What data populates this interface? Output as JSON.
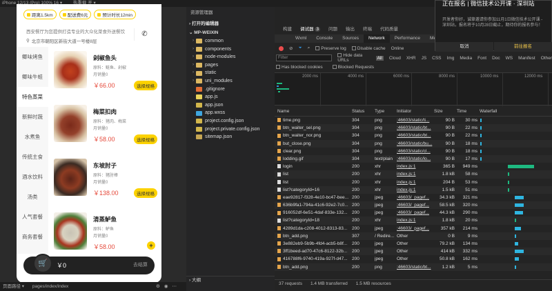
{
  "topbar": {
    "device": "iPhone 12/13 (Pro) 100% 16 ▾",
    "hot_reload": "热重载 开 ▾",
    "explorer_title": "资源管理器"
  },
  "phone": {
    "badges": [
      {
        "icon": "location-icon",
        "text": "距离1.5km"
      },
      {
        "icon": "delivery-icon",
        "text": "配送费6元"
      },
      {
        "icon": "clock-icon",
        "text": "预计时长12min"
      }
    ],
    "notice": "西安餐厅为您提供打造专业的大众化菜食外送餐饮",
    "address": "北京市朝阳区新街大道一号楼8层",
    "categories": [
      "鲫味烤鱼",
      "鲫味牛蛙",
      "特色蒸菜",
      "新鲜时蔬",
      "水煮鱼",
      "传统主食",
      "酒水饮料",
      "汤类",
      "人气套餐",
      "商务套餐"
    ],
    "active_category": "特色蒸菜",
    "goods": [
      {
        "name": "剁椒鱼头",
        "material": "原料：鲢鱼、剁椒",
        "sales": "月销量0",
        "price": "￥66.00",
        "action": "选择规格"
      },
      {
        "name": "梅菜扣肉",
        "material": "原料：猪肉、梅菜",
        "sales": "月销量0",
        "price": "￥58.00",
        "action": "选择规格"
      },
      {
        "name": "东坡肘子",
        "material": "原料：猪肘棒",
        "sales": "月销量0",
        "price": "￥138.00",
        "action": "选择规格"
      },
      {
        "name": "清蒸鲈鱼",
        "material": "原料：鲈鱼",
        "sales": "月销量0",
        "price": "￥58.00",
        "action": "+"
      }
    ],
    "cart": {
      "amount": "￥0",
      "right_text": "去结算"
    }
  },
  "statusbar": {
    "path_label": "页面路径 ▾",
    "path": "pages/index/index"
  },
  "explorer": {
    "title": "资源管理器",
    "open_editors": "打开的编辑器",
    "project": "MP-WEIXIN",
    "items": [
      {
        "name": "common",
        "type": "folder"
      },
      {
        "name": "components",
        "type": "folder"
      },
      {
        "name": "node-modules",
        "type": "folder"
      },
      {
        "name": "pages",
        "type": "folder"
      },
      {
        "name": "static",
        "type": "folder"
      },
      {
        "name": "uni_modules",
        "type": "folder"
      },
      {
        "name": ".gitignore",
        "type": "git"
      },
      {
        "name": "app.js",
        "type": "js"
      },
      {
        "name": "app.json",
        "type": "json"
      },
      {
        "name": "app.wxss",
        "type": "wxss"
      },
      {
        "name": "project.config.json",
        "type": "json"
      },
      {
        "name": "project.private.config.json",
        "type": "json"
      },
      {
        "name": "sitemap.json",
        "type": "map"
      }
    ],
    "outline": "大纲"
  },
  "devtools": {
    "panel_tabs": [
      "构建",
      "调试器",
      "问题",
      "输出",
      "终端",
      "代码质量"
    ],
    "panel_badge": "3",
    "active_panel": "调试器",
    "tabs": [
      "Wxml",
      "Console",
      "Sources",
      "Network",
      "Performance",
      "Memory"
    ],
    "active_tab": "Network",
    "toolbar": {
      "preserve_log": "Preserve log",
      "disable_cache": "Disable cache",
      "throttle": "Online"
    },
    "filter": {
      "placeholder": "Filter",
      "hide_data_urls": "Hide data URLs",
      "types": [
        "All",
        "Cloud",
        "XHR",
        "JS",
        "CSS",
        "Img",
        "Media",
        "Font",
        "Doc",
        "WS",
        "Manifest",
        "Other"
      ],
      "active_type": "All"
    },
    "blocked": {
      "cookies": "Has blocked cookies",
      "requests": "Blocked Requests"
    },
    "timeline_labels": [
      "2000 ms",
      "4000 ms",
      "6000 ms",
      "8000 ms",
      "10000 ms",
      "12000 ms"
    ],
    "columns": [
      "Name",
      "Status",
      "Type",
      "Initiator",
      "Size",
      "Time",
      "Waterfall"
    ],
    "rows": [
      {
        "name": "time.png",
        "status": "304",
        "type": "png",
        "initiator": ":46603/static/ti...",
        "size": "90 B",
        "time": "30 ms"
      },
      {
        "name": "btn_waiter_sel.png",
        "status": "304",
        "type": "png",
        "initiator": ":46603/static/bt...",
        "size": "90 B",
        "time": "22 ms"
      },
      {
        "name": "btn_waiter_nor.png",
        "status": "304",
        "type": "png",
        "initiator": ":46603/static/bt...",
        "size": "90 B",
        "time": "22 ms"
      },
      {
        "name": "but_close.png",
        "status": "304",
        "type": "png",
        "initiator": ":46603/static/bu...",
        "size": "90 B",
        "time": "18 ms"
      },
      {
        "name": "clear.png",
        "status": "304",
        "type": "png",
        "initiator": ":46603/static/cl...",
        "size": "90 B",
        "time": "18 ms"
      },
      {
        "name": "lodding.gif",
        "status": "304",
        "type": "text/plain",
        "initiator": ":46603/static/lo...",
        "size": "90 B",
        "time": "17 ms"
      },
      {
        "name": "login",
        "status": "200",
        "type": "xhr",
        "initiator": "index.js:1",
        "size": "365 B",
        "time": "949 ms"
      },
      {
        "name": "list",
        "status": "200",
        "type": "xhr",
        "initiator": "index.js:1",
        "size": "1.8 kB",
        "time": "58 ms"
      },
      {
        "name": "list",
        "status": "200",
        "type": "xhr",
        "initiator": "index.js:1",
        "size": "204 B",
        "time": "53 ms"
      },
      {
        "name": "list?categoryId=16",
        "status": "200",
        "type": "xhr",
        "initiator": "index.js:1",
        "size": "1.5 kB",
        "time": "51 ms"
      },
      {
        "name": "eae92817-f328-4e10-bc47-bee...",
        "status": "200",
        "type": "jpeg",
        "initiator": ":46603/_pagef...",
        "size": "34.3 kB",
        "time": "321 ms"
      },
      {
        "name": "636b9fa1-794a-41c6-92e2-7c0...",
        "status": "200",
        "type": "jpeg",
        "initiator": ":46603/_pagef...",
        "size": "58.5 kB",
        "time": "320 ms"
      },
      {
        "name": "916052df-6e51-4daf-833e-132...",
        "status": "200",
        "type": "jpeg",
        "initiator": ":46603/_pagef...",
        "size": "44.3 kB",
        "time": "290 ms"
      },
      {
        "name": "list?categoryId=18",
        "status": "200",
        "type": "xhr",
        "initiator": "index.js:1",
        "size": "1.8 kB",
        "time": "20 ms"
      },
      {
        "name": "4289d1da-c208-4012-8313-83...",
        "status": "200",
        "type": "jpeg",
        "initiator": ":46603/_pagef...",
        "size": "357 kB",
        "time": "214 ms"
      },
      {
        "name": "btn_add.png",
        "status": "307",
        "type": "/ Redire...",
        "initiator": "Other",
        "size": "0 B",
        "time": "9 ms"
      },
      {
        "name": "3e882eb9-5b9b-4fd4-acb5-b8f...",
        "status": "200",
        "type": "jpeg",
        "initiator": "Other",
        "size": "79.2 kB",
        "time": "134 ms"
      },
      {
        "name": "3ff1beed-ad70-47c6-8122-32b...",
        "status": "200",
        "type": "jpeg",
        "initiator": "Other",
        "size": "414 kB",
        "time": "332 ms"
      },
      {
        "name": "416788f6-9740-419a-927f-d47...",
        "status": "200",
        "type": "jpeg",
        "initiator": "Other",
        "size": "50.8 kB",
        "time": "162 ms"
      },
      {
        "name": "btn_add.png",
        "status": "200",
        "type": "png",
        "initiator": ":46603/static/bt...",
        "size": "1.2 kB",
        "time": "5 ms"
      }
    ],
    "footer": {
      "requests": "37 requests",
      "transferred": "1.4 MB transferred",
      "resources": "1.5 MB resources"
    }
  },
  "notification": {
    "title": "正在报名 | 微信技术公开课 · 深圳站",
    "body": "开发者你好，诚挚邀请你参加11月1日微信技术公开课 - 深圳站，报名将于10月28日截止，期待你的报名参与！",
    "cancel": "取消",
    "confirm": "前往报名"
  },
  "colors": {
    "accent": "#fcd200",
    "price": "#e5493a",
    "recording": "#e94c4c"
  }
}
